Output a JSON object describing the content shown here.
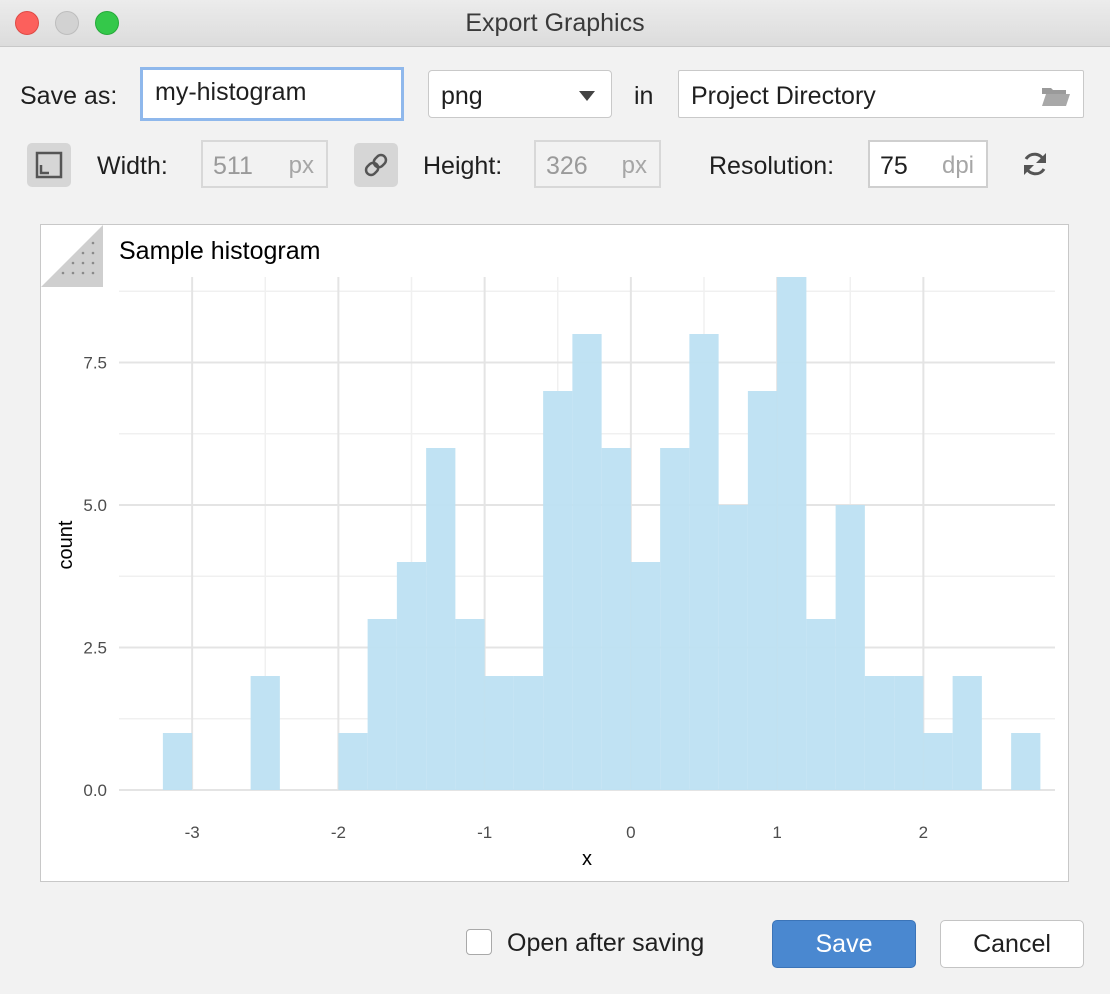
{
  "window": {
    "title": "Export Graphics"
  },
  "save_row": {
    "save_as_label": "Save as:",
    "filename": "my-histogram",
    "format": "png",
    "in_label": "in",
    "directory": "Project Directory"
  },
  "size_row": {
    "width_label": "Width:",
    "width_value": "511",
    "width_unit": "px",
    "height_label": "Height:",
    "height_value": "326",
    "height_unit": "px",
    "resolution_label": "Resolution:",
    "resolution_value": "75",
    "resolution_unit": "dpi"
  },
  "chart_data": {
    "type": "bar",
    "title": "Sample histogram",
    "xlabel": "x",
    "ylabel": "count",
    "bin_width": 0.2,
    "bin_starts": [
      -3.2,
      -3.0,
      -2.8,
      -2.6,
      -2.4,
      -2.2,
      -2.0,
      -1.8,
      -1.6,
      -1.4,
      -1.2,
      -1.0,
      -0.8,
      -0.6,
      -0.4,
      -0.2,
      0.0,
      0.2,
      0.4,
      0.6,
      0.8,
      1.0,
      1.2,
      1.4,
      1.6,
      1.8,
      2.0,
      2.2,
      2.4
    ],
    "values": [
      1,
      0,
      0,
      2,
      0,
      0,
      1,
      3,
      4,
      6,
      3,
      2,
      2,
      7,
      8,
      6,
      4,
      6,
      8,
      5,
      7,
      9,
      3,
      5,
      2,
      2,
      1,
      2,
      0,
      1
    ],
    "xlim": [
      -3.5,
      2.9
    ],
    "ylim": [
      0,
      9
    ],
    "x_ticks": [
      -3,
      -2,
      -1,
      0,
      1,
      2
    ],
    "x_tick_labels": [
      "-3",
      "-2",
      "-1",
      "0",
      "1",
      "2"
    ],
    "y_ticks": [
      0,
      2.5,
      5.0,
      7.5
    ],
    "y_tick_labels": [
      "0.0",
      "2.5",
      "5.0",
      "7.5"
    ],
    "grid": true,
    "bar_color": "#bde0f2"
  },
  "footer": {
    "open_after_saving_label": "Open after saving",
    "open_after_saving_checked": false,
    "save_label": "Save",
    "cancel_label": "Cancel"
  },
  "colors": {
    "accent": "#4a88d0",
    "focus_ring": "#8fb8ec"
  }
}
